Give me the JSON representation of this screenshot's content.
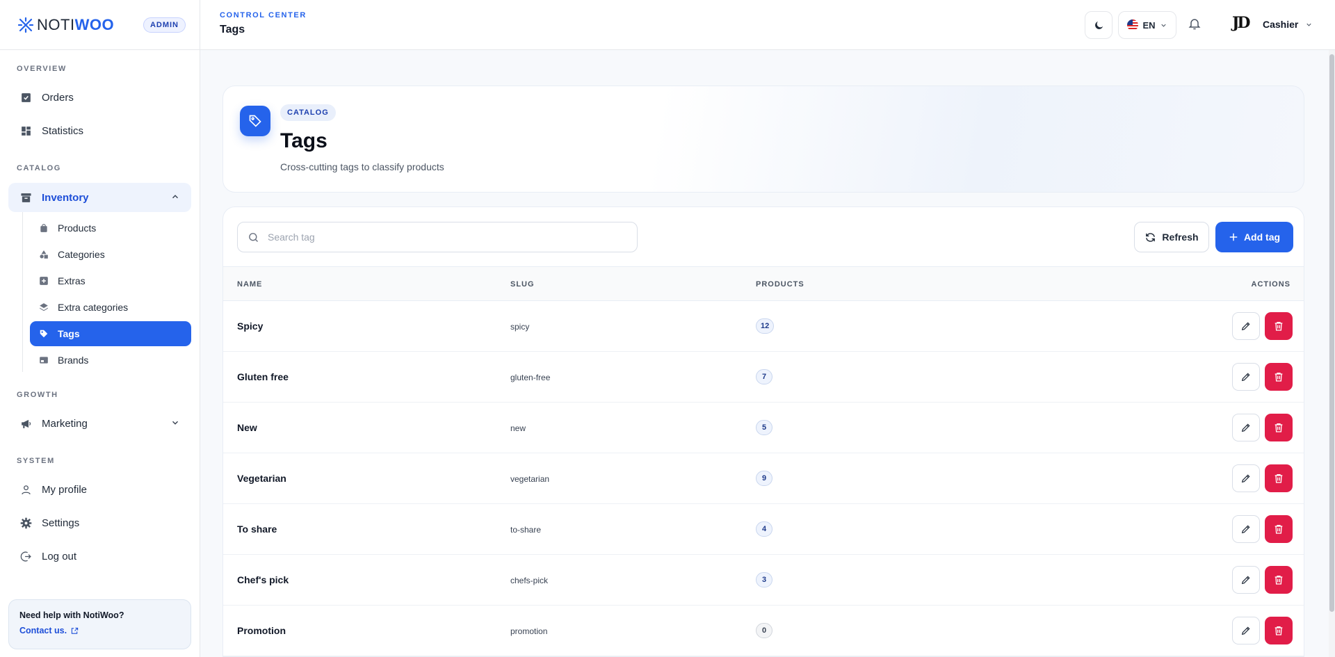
{
  "brand": {
    "logo_a": "NOTI",
    "logo_b": "WOO",
    "role_badge": "ADMIN"
  },
  "sidebar": {
    "sections": {
      "overview": "OVERVIEW",
      "catalog": "CATALOG",
      "growth": "GROWTH",
      "system": "SYSTEM"
    },
    "orders": "Orders",
    "statistics": "Statistics",
    "inventory": "Inventory",
    "sub": [
      "Products",
      "Categories",
      "Extras",
      "Extra categories",
      "Tags",
      "Brands"
    ],
    "marketing": "Marketing",
    "profile": "My profile",
    "settings": "Settings",
    "logout": "Log out",
    "help_question": "Need help with NotiWoo?",
    "help_link": "Contact us."
  },
  "topbar": {
    "crumb": "CONTROL CENTER",
    "title": "Tags",
    "language": "EN",
    "avatar_initials": "JD",
    "user": "Cashier"
  },
  "hero": {
    "badge": "CATALOG",
    "title": "Tags",
    "subtitle": "Cross-cutting tags to classify products"
  },
  "toolbar": {
    "search_placeholder": "Search tag",
    "refresh": "Refresh",
    "add": "Add tag"
  },
  "table": {
    "headers": {
      "name": "NAME",
      "slug": "SLUG",
      "products": "PRODUCTS",
      "actions": "ACTIONS"
    },
    "rows": [
      {
        "name": "Spicy",
        "slug": "spicy",
        "products": "12"
      },
      {
        "name": "Gluten free",
        "slug": "gluten-free",
        "products": "7"
      },
      {
        "name": "New",
        "slug": "new",
        "products": "5"
      },
      {
        "name": "Vegetarian",
        "slug": "vegetarian",
        "products": "9"
      },
      {
        "name": "To share",
        "slug": "to-share",
        "products": "4"
      },
      {
        "name": "Chef's pick",
        "slug": "chefs-pick",
        "products": "3"
      },
      {
        "name": "Promotion",
        "slug": "promotion",
        "products": "0"
      }
    ]
  },
  "colors": {
    "accent": "#2563eb",
    "danger": "#e11d48"
  }
}
